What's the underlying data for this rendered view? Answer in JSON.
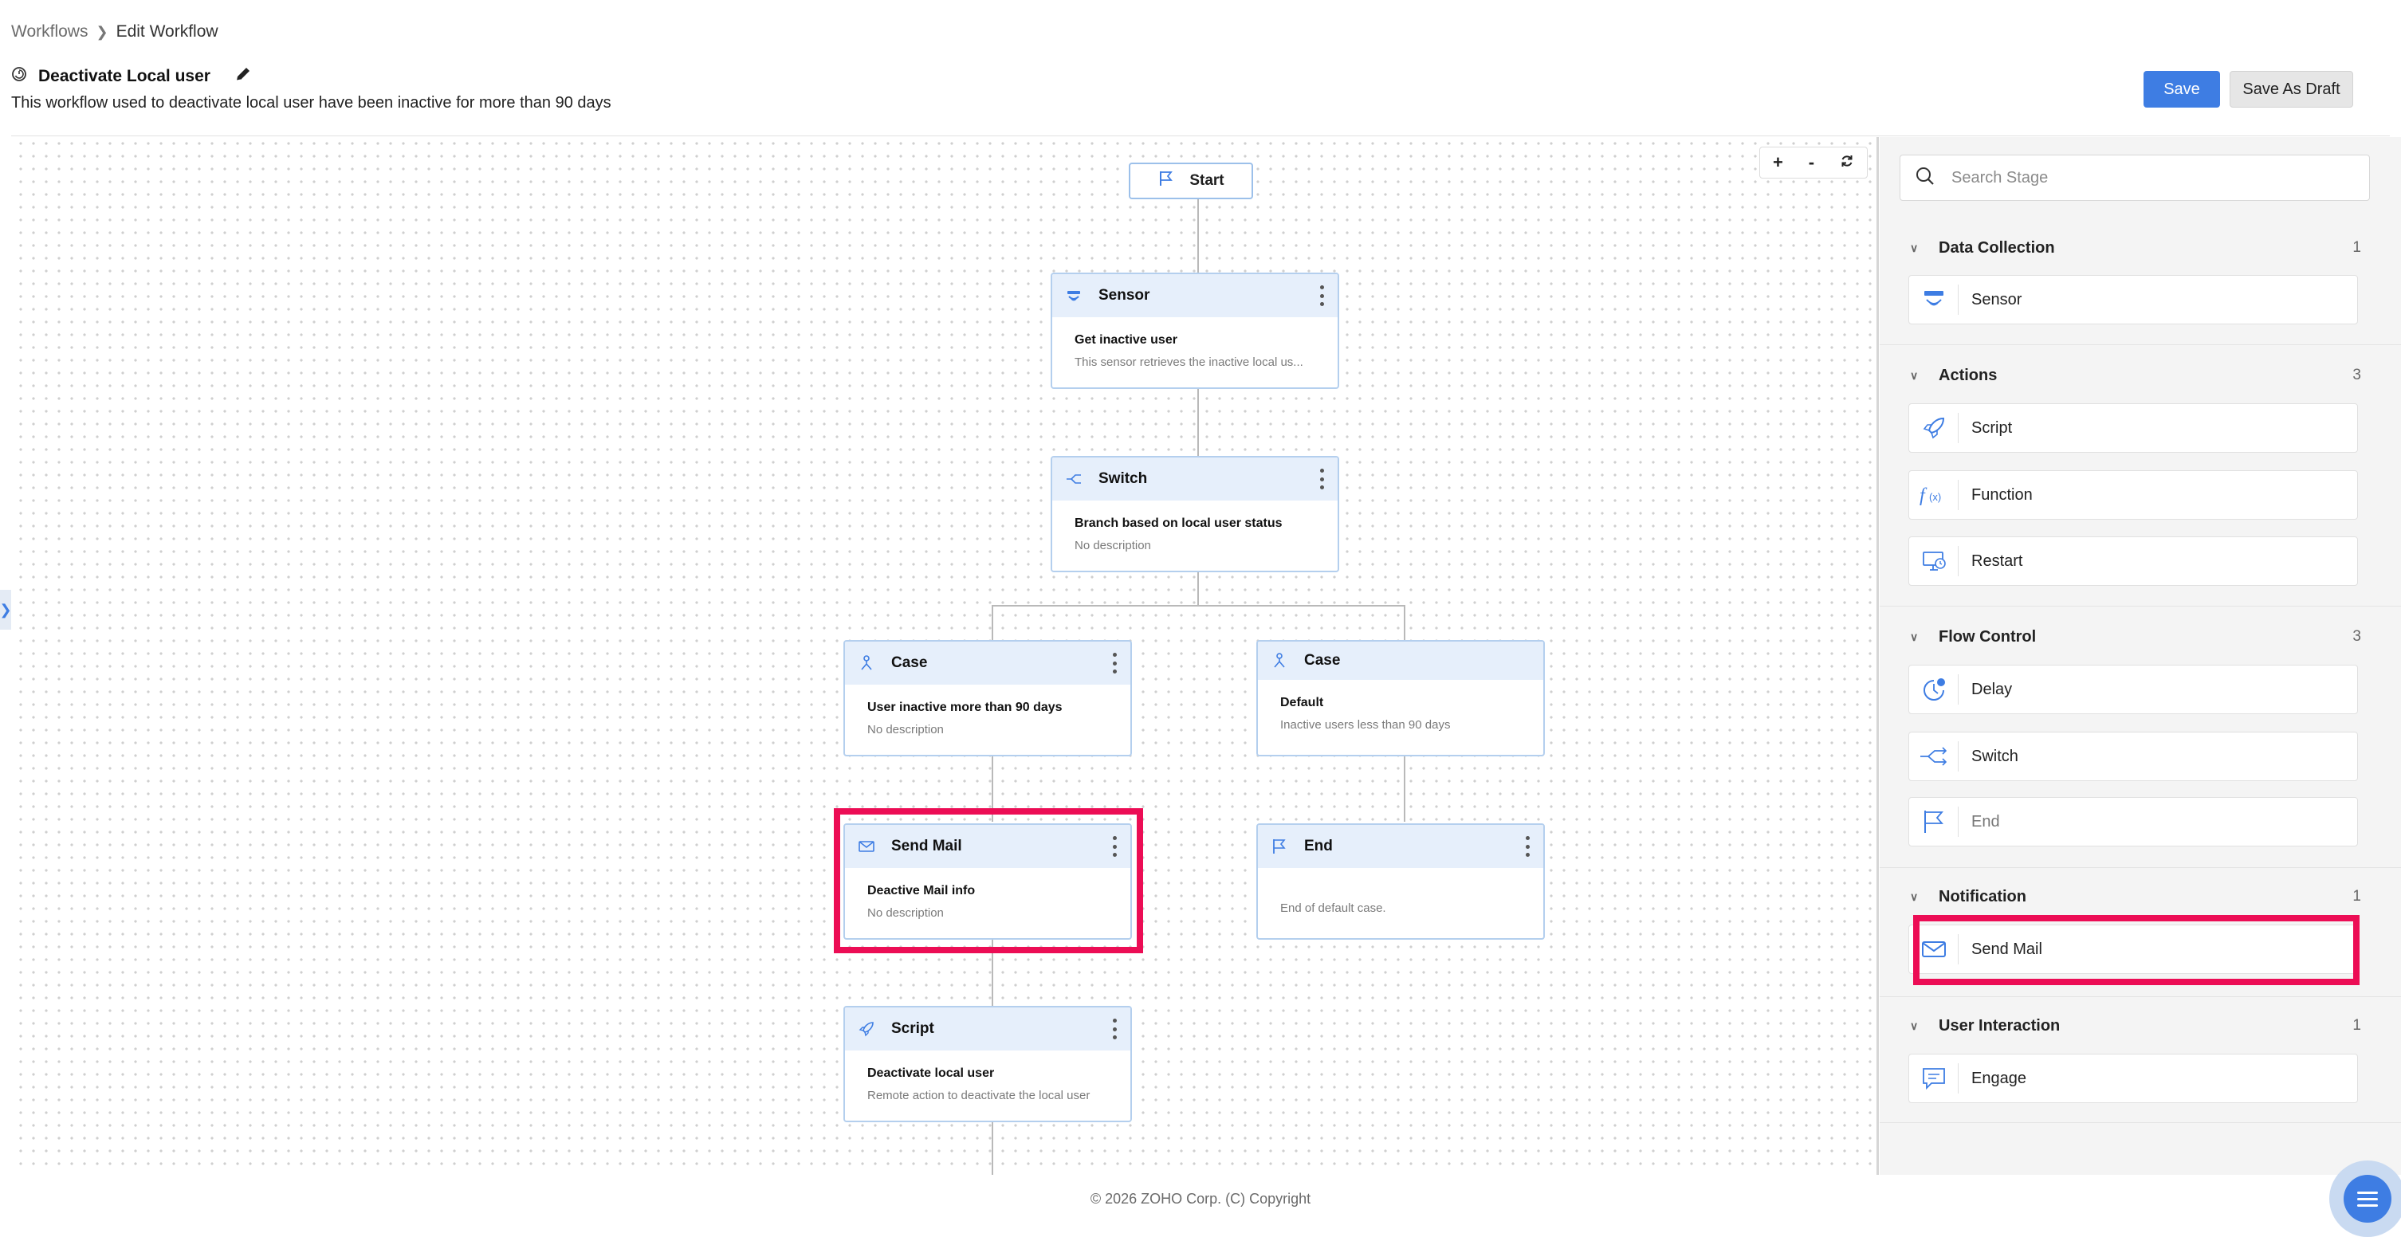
{
  "breadcrumb": {
    "root": "Workflows",
    "current": "Edit Workflow"
  },
  "workflow": {
    "name": "Deactivate Local user",
    "description": "This workflow used to deactivate local user have been inactive for more than 90 days"
  },
  "toolbar": {
    "save_label": "Save",
    "draft_label": "Save As Draft"
  },
  "zoom": {
    "in": "+",
    "out": "-"
  },
  "canvas": {
    "start_label": "Start",
    "nodes": {
      "sensor": {
        "type": "Sensor",
        "label": "Get inactive user",
        "desc": "This sensor retrieves the inactive local us..."
      },
      "switch": {
        "type": "Switch",
        "label": "Branch based on local user status",
        "desc": "No description"
      },
      "case1": {
        "type": "Case",
        "label": "User inactive more than 90 days",
        "desc": "No description"
      },
      "case2": {
        "type": "Case",
        "label": "Default",
        "desc": "Inactive users less than 90 days"
      },
      "sendmail": {
        "type": "Send Mail",
        "label": "Deactive Mail info",
        "desc": "No description"
      },
      "end": {
        "type": "End",
        "desc": "End of default case."
      },
      "script": {
        "type": "Script",
        "label": "Deactivate local user",
        "desc": "Remote action to deactivate the local user"
      }
    }
  },
  "panel": {
    "search_placeholder": "Search Stage",
    "sections": {
      "data_collection": {
        "title": "Data Collection",
        "count": "1",
        "items": [
          "Sensor"
        ]
      },
      "actions": {
        "title": "Actions",
        "count": "3",
        "items": [
          "Script",
          "Function",
          "Restart"
        ]
      },
      "flow_control": {
        "title": "Flow Control",
        "count": "3",
        "items": [
          "Delay",
          "Switch",
          "End"
        ]
      },
      "notification": {
        "title": "Notification",
        "count": "1",
        "items": [
          "Send Mail"
        ]
      },
      "user_interaction": {
        "title": "User Interaction",
        "count": "1",
        "items": [
          "Engage"
        ]
      }
    }
  },
  "footer": {
    "text": "© 2026 ZOHO Corp. (C) Copyright"
  },
  "colors": {
    "accent": "#3e7de3",
    "highlight": "#ec0d55",
    "node_header": "#e6effb"
  }
}
